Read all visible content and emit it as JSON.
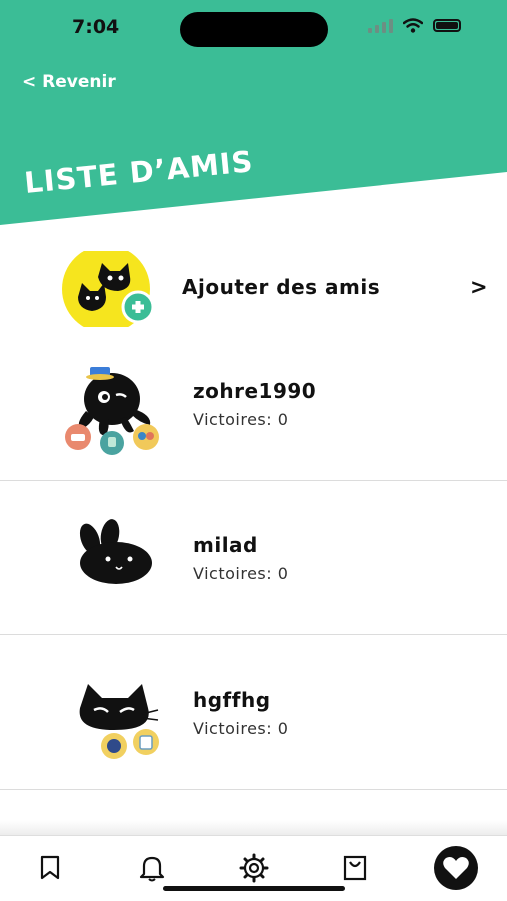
{
  "status_bar": {
    "time": "7:04"
  },
  "header": {
    "back_label": "< Revenir",
    "title": "LISTE D’AMIS",
    "color": "#3bbd96"
  },
  "add_friends": {
    "label": "Ajouter des amis",
    "chevron": ">"
  },
  "friends": [
    {
      "name": "zohre1990",
      "wins": "Victoires: 0",
      "avatar": "octopus-icon"
    },
    {
      "name": "milad",
      "wins": "Victoires: 0",
      "avatar": "rabbit-icon"
    },
    {
      "name": "hgffhg",
      "wins": "Victoires: 0",
      "avatar": "cat-icon"
    }
  ],
  "tab_bar": {
    "items": [
      "bookmark-icon",
      "bell-icon",
      "gear-icon",
      "bag-icon",
      "heart-icon"
    ],
    "active": "heart-icon"
  }
}
